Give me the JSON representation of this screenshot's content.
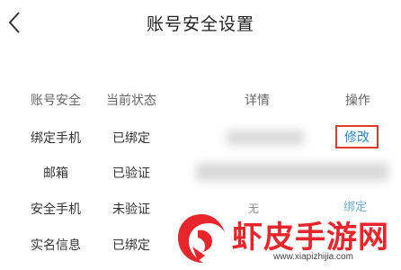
{
  "header": {
    "title": "账号安全设置",
    "back_icon": "chevron-left-icon"
  },
  "table": {
    "headers": [
      "账号安全",
      "当前状态",
      "详情",
      "操作"
    ],
    "rows": [
      {
        "name": "绑定手机",
        "status": "已绑定",
        "action": "修改"
      },
      {
        "name": "邮箱",
        "status": "已验证"
      },
      {
        "name": "安全手机",
        "status": "未验证",
        "detail_partial": "无",
        "action": "绑定"
      },
      {
        "name": "实名信息",
        "status": "已绑定"
      }
    ]
  },
  "colors": {
    "highlight_border": "#e03a2b",
    "link": "#2a86c9",
    "watermark": "#e6262a"
  },
  "watermark": {
    "title": "虾皮手游网",
    "url": "www.xiapizhijia.com"
  }
}
